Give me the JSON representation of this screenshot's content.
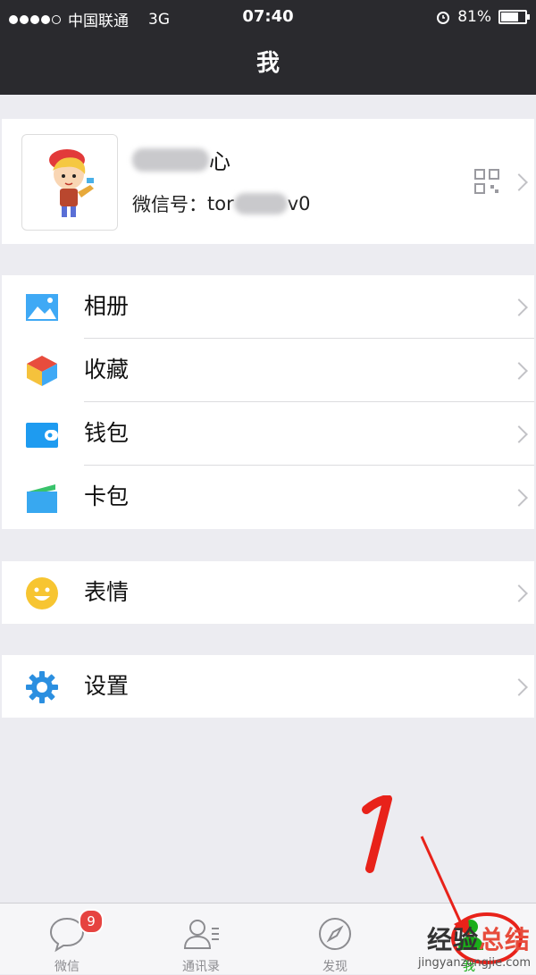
{
  "status_bar": {
    "carrier": "中国联通",
    "network": "3G",
    "time": "07:40",
    "battery": "81%",
    "battery_level": 0.81,
    "signal_bars": 4
  },
  "nav": {
    "title": "我"
  },
  "profile": {
    "name_visible": "心",
    "wechat_id_label": "微信号：",
    "wechat_id_prefix": "tor",
    "wechat_id_suffix": "v0",
    "qr_icon": "qr-code-icon",
    "avatar_icon": "cartoon-avatar"
  },
  "menu_groups": [
    {
      "items": [
        {
          "label": "相册",
          "icon": "album-icon"
        },
        {
          "label": "收藏",
          "icon": "favorites-icon"
        },
        {
          "label": "钱包",
          "icon": "wallet-icon"
        },
        {
          "label": "卡包",
          "icon": "card-pack-icon"
        }
      ]
    },
    {
      "items": [
        {
          "label": "表情",
          "icon": "sticker-icon"
        }
      ]
    },
    {
      "items": [
        {
          "label": "设置",
          "icon": "settings-icon"
        }
      ]
    }
  ],
  "tab_bar": {
    "tabs": [
      {
        "label": "微信",
        "icon": "chat-bubble-icon",
        "badge": "9"
      },
      {
        "label": "通讯录",
        "icon": "contacts-icon"
      },
      {
        "label": "发现",
        "icon": "compass-icon"
      },
      {
        "label": "我",
        "icon": "me-icon",
        "active": true
      }
    ]
  },
  "annotation": {
    "number": "1"
  },
  "watermark": {
    "text_a": "经验",
    "text_b": "总结",
    "url": "jingyanzongjie.com"
  },
  "colors": {
    "header": "#2a2a2e",
    "accent_green": "#1aad19",
    "badge_red": "#e64340",
    "annot_red": "#e8221a"
  }
}
